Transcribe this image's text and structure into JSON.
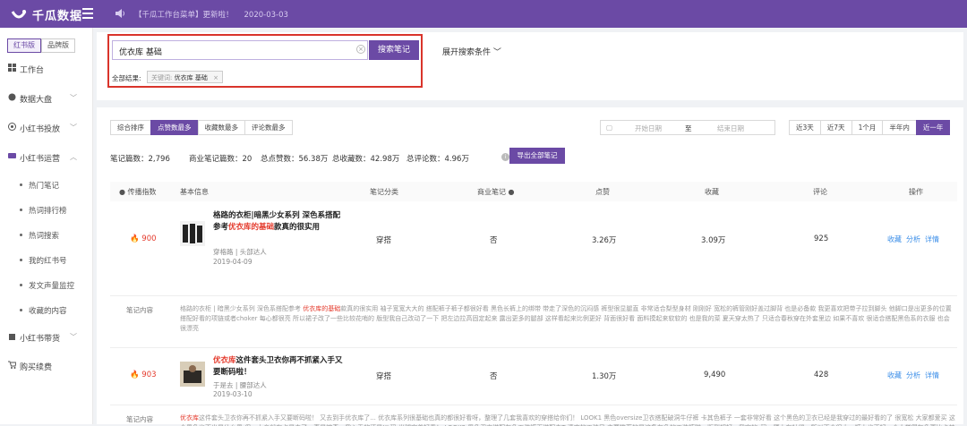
{
  "app": {
    "name": "千瓜数据",
    "notice": "【千瓜工作台菜单】更新啦！",
    "notice_date": "2020-03-03"
  },
  "sidebar": {
    "version_tabs": [
      "红书版",
      "品牌版"
    ],
    "nav": [
      {
        "label": "工作台"
      },
      {
        "label": "数据大盘"
      },
      {
        "label": "小红书投放"
      },
      {
        "label": "小红书运营"
      }
    ],
    "sub": [
      "热门笔记",
      "热词排行榜",
      "热词搜索",
      "我的红书号",
      "发文声量监控",
      "收藏的内容"
    ],
    "nav2": [
      {
        "label": "小红书带货"
      },
      {
        "label": "购买续费"
      }
    ]
  },
  "search": {
    "value": "优衣库 基础",
    "button": "搜索笔记",
    "filter_label": "全部结果:",
    "tag_key": "关键词:",
    "tag_value": "优衣库 基础",
    "tag_close": "×",
    "expand": "展开搜索条件"
  },
  "sort_tabs": [
    "综合排序",
    "点赞数最多",
    "收藏数最多",
    "评论数最多"
  ],
  "date": {
    "start": "开始日期",
    "sep": "至",
    "end": "结束日期"
  },
  "ranges": [
    "近3天",
    "近7天",
    "1个月",
    "半年内",
    "近一年"
  ],
  "stats": [
    {
      "label": "笔记篇数：",
      "value": "2,796"
    },
    {
      "label": "商业笔记篇数：",
      "value": "20"
    },
    {
      "label": "总点赞数：",
      "value": "56.38万"
    },
    {
      "label": "总收藏数：",
      "value": "42.98万"
    },
    {
      "label": "总评论数：",
      "value": "4.96万"
    }
  ],
  "export": "导出全部笔记",
  "table_headers": [
    "传播指数",
    "基本信息",
    "笔记分类",
    "商业笔记",
    "点赞",
    "收藏",
    "评论",
    "操作"
  ],
  "rows": [
    {
      "heat": "900",
      "title_a": "格路的衣柜|暗黑少女系列 深色系搭配参考",
      "title_b": "优衣库的基础",
      "title_c": "款真的很实用",
      "author": "穿格路 | 头部达人",
      "date": "2019-04-09",
      "category": "穿搭",
      "commercial": "否",
      "likes": "3.26万",
      "collects": "3.09万",
      "comments": "925",
      "ops": [
        "收藏",
        "分析",
        "详情"
      ],
      "content_label": "笔记内容",
      "content_a": "格路的衣柜 | 暗黑少女系列 深色系搭配参考 ",
      "content_b": "优衣库的基础",
      "content_c": "款真的很实用 袖子宽宽大大的 搭配裤子裤子都很好看 黑色长裤上的绑带 带走了深色的沉闷感 裤型很显腿直 非常适合梨型身材 刚刚好 宽松的裤管刚好盖过脚背 也是必备款 我更喜欢把带子拉到脚头 他脚口是出更多的位置 搭配好看的项链或者choker 每心都很亮 所以裙子改了一些比较花哨的 版型我自己改动了一下 把左边拉高固定起来 露出更多的腿部 这样看起来比例更好 背面很好看 面料摸起来软软的 也是我的菜 夏天穿太热了 只适合春秋穿在外套里边 如果不喜欢 很适合搭配黑色系的衣服 也会很漂亮"
    },
    {
      "heat": "903",
      "title_a": "",
      "title_b": "优衣库",
      "title_c": "这件套头卫衣你再不抓紧入手又要断码啦！",
      "author": "于是去 | 腰部达人",
      "date": "2019-03-10",
      "category": "穿搭",
      "commercial": "否",
      "likes": "1.30万",
      "collects": "9,490",
      "comments": "428",
      "ops": [
        "收藏",
        "分析",
        "详情"
      ],
      "content_label": "笔记内容",
      "content_a": "",
      "content_b": "优衣库",
      "content_c": "这件套头卫衣你再不抓紧入手又要断码啦！ 又去到手优衣库了... 优衣库系列很基础也真的都很好看呀，整理了几套我喜欢的穿搭给你们！ LOOK1 黑色oversize卫衣搭配破洞牛仔裤 卡其色裤子 一套非常好看 这个黑色的卫衣已经是我穿过的最好看的了 很宽松 大家都爱买 这个黑色也不出显什么黑 但一上身就有点显白了，真是神奇，我入手的还是XL码 光腿穿着好看！ LOOK2 黑色卫衣搭配灰色工装裤再搭配白T 清爽的工装风 主要推荐的是这条灰色的工装裤啦，版型超好，我穿的s码，腰上有抽绳，所以不会很大，裤上也正好，个人觉得灰色更比卡其色好看 灰色可以搭各种颜色！ LOOK3 基础卡其卫衣搭配黑色裤子 这种中规中矩的一套都"
    }
  ]
}
